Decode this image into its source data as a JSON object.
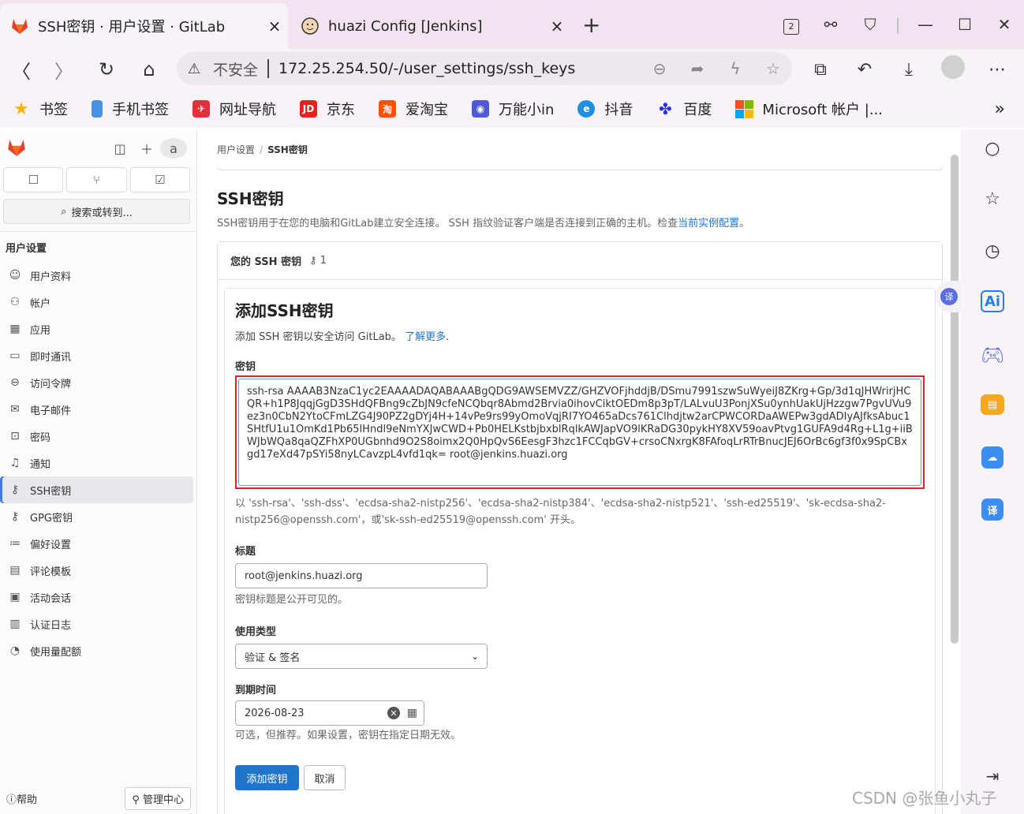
{
  "browser": {
    "tabs": [
      {
        "title": "SSH密钥 · 用户设置 · GitLab",
        "close": "×",
        "active": true
      },
      {
        "title": "huazi Config [Jenkins]",
        "close": "×",
        "active": false
      }
    ],
    "new_tab": "+",
    "tab_count_badge": "2",
    "address": {
      "insecure_label": "不安全",
      "url": "172.25.254.50/-/user_settings/ssh_keys"
    },
    "bookmarks": [
      {
        "label": "书签",
        "icon": "star-icon"
      },
      {
        "label": "手机书签",
        "icon": "phone-icon"
      },
      {
        "label": "网址导航",
        "icon": "nav-icon"
      },
      {
        "label": "京东",
        "icon": "jd-icon",
        "icon_text": "JD"
      },
      {
        "label": "爱淘宝",
        "icon": "taobao-icon",
        "icon_text": "淘"
      },
      {
        "label": "万能小in",
        "icon": "robot-icon"
      },
      {
        "label": "抖音",
        "icon": "douyin-icon"
      },
      {
        "label": "百度",
        "icon": "baidu-icon"
      },
      {
        "label": "Microsoft 帐户 |...",
        "icon": "microsoft-icon"
      }
    ],
    "bookmarks_more": "»"
  },
  "sidebar": {
    "avatar_alt": "a",
    "search_label": "搜索或转到...",
    "section_title": "用户设置",
    "items": [
      {
        "label": "用户资料",
        "icon": "profile-icon",
        "glyph": "☺"
      },
      {
        "label": "帐户",
        "icon": "account-icon",
        "glyph": "⚇"
      },
      {
        "label": "应用",
        "icon": "applications-icon",
        "glyph": "▦"
      },
      {
        "label": "即时通讯",
        "icon": "chat-icon",
        "glyph": "▭"
      },
      {
        "label": "访问令牌",
        "icon": "token-icon",
        "glyph": "⊖"
      },
      {
        "label": "电子邮件",
        "icon": "email-icon",
        "glyph": "✉"
      },
      {
        "label": "密码",
        "icon": "lock-icon",
        "glyph": "⊡"
      },
      {
        "label": "通知",
        "icon": "bell-icon",
        "glyph": "♫"
      },
      {
        "label": "SSH密钥",
        "icon": "key-icon",
        "glyph": "⚷",
        "active": true
      },
      {
        "label": "GPG密钥",
        "icon": "gpg-key-icon",
        "glyph": "⚷"
      },
      {
        "label": "偏好设置",
        "icon": "preferences-icon",
        "glyph": "≔"
      },
      {
        "label": "评论模板",
        "icon": "comment-template-icon",
        "glyph": "▤"
      },
      {
        "label": "活动会话",
        "icon": "session-icon",
        "glyph": "▣"
      },
      {
        "label": "认证日志",
        "icon": "log-icon",
        "glyph": "▥"
      },
      {
        "label": "使用量配额",
        "icon": "quota-icon",
        "glyph": "◔"
      }
    ],
    "help_label": "帮助",
    "admin_label": "管理中心"
  },
  "page": {
    "breadcrumb": [
      "用户设置",
      "SSH密钥"
    ],
    "title": "SSH密钥",
    "description": "SSH密钥用于在您的电脑和GitLab建立安全连接。 SSH 指纹验证客户端是否连接到正确的主机。检查",
    "description_link": "当前实例配置",
    "description_end": "。",
    "keys_header": "您的 SSH 密钥",
    "keys_count": "1",
    "form": {
      "title": "添加SSH密钥",
      "subtitle": "添加 SSH 密钥以安全访问 GitLab。",
      "learn_more": "了解更多",
      "subtitle_end": ".",
      "key_label": "密钥",
      "key_value": "ssh-rsa AAAAB3NzaC1yc2EAAAADAQABAAABgQDG9AWSEMVZZ/GHZVOFjhddjB/DSmu7991szwSuWyeiJ8ZKrg+Gp/3d1qJHWrirjHCQR+h1P8JqqjGgD3SHdQFBng9cZbJN9cfeNCQbqr8Abmd2Brvia0ihovCiktOEDm8p3pT/LALvuU3PonjXSu0ynhUakUjHzzgw7PgvUVu9ez3n0CbN2YtoCFmLZG4J90PZ2gDYj4H+14vPe9rs99yOmoVqjRI7YO465aDcs761Clhdjtw2arCPWCORDaAWEPw3gdADIyAJfksAbuc1SHtfU1u1OmKd1Pb65lHndl9eNmYXJwCWD+Pb0HELKstbjbxblRqlkAWJapVO9lKRaDG30pykHY8XV59oavPtvg1GUFA9d4Rg+L1g+iiBWJbWQa8qaQZFhXP0UGbnhd9O2S8oimx2Q0HpQvS6EesgF3hzc1FCCqbGV+crsoCNxrgK8FAfoqLrRTrBnucJEJ6OrBc6gf3f0x9SpCBxgd17eXd47pSYi58nyLCavzpL4vfd1qk= root@jenkins.huazi.org",
      "key_hint": "以 'ssh-rsa'、'ssh-dss'、'ecdsa-sha2-nistp256'、'ecdsa-sha2-nistp384'、'ecdsa-sha2-nistp521'、'ssh-ed25519'、'sk-ecdsa-sha2-nistp256@openssh.com'，或'sk-ssh-ed25519@openssh.com' 开头。",
      "title_label": "标题",
      "title_value": "root@jenkins.huazi.org",
      "title_hint": "密钥标题是公开可见的。",
      "usage_label": "使用类型",
      "usage_value": "验证 & 签名",
      "expiry_label": "到期时间",
      "expiry_value": "2026-08-23",
      "expiry_hint": "可选，但推荐。如果设置，密钥在指定日期无效。",
      "submit_label": "添加密钥",
      "cancel_label": "取消"
    }
  },
  "float_translate": "译",
  "edge_bar": [
    "search-icon",
    "star-icon",
    "clock-icon",
    "ai-icon",
    "game-icon",
    "briefcase-icon",
    "cloud-icon",
    "translate-icon"
  ],
  "watermark": "CSDN @张鱼小丸子",
  "colors": {
    "accent": "#1f75cb",
    "highlight_border": "#d7262a",
    "gitlab_orange": "#e24329"
  }
}
